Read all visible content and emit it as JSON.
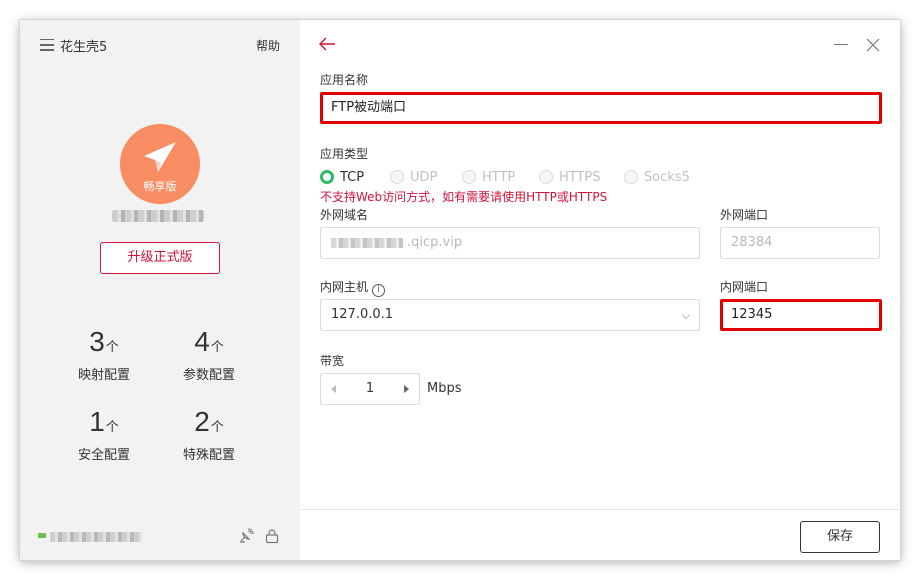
{
  "app": {
    "title": "花生壳5",
    "help": "帮助"
  },
  "sidebar": {
    "logo_badge": "畅享版",
    "upgrade_label": "升级正式版",
    "unit": "个",
    "stats": [
      {
        "value": "3",
        "label": "映射配置"
      },
      {
        "value": "4",
        "label": "参数配置"
      },
      {
        "value": "1",
        "label": "安全配置"
      },
      {
        "value": "2",
        "label": "特殊配置"
      }
    ]
  },
  "form": {
    "app_name_label": "应用名称",
    "app_name_value": "FTP被动端口",
    "app_type_label": "应用类型",
    "types": [
      "TCP",
      "UDP",
      "HTTP",
      "HTTPS",
      "Socks5"
    ],
    "selected_type": "TCP",
    "warning": "不支持Web访问方式，如有需要请使用HTTP或HTTPS",
    "external_domain_label": "外网域名",
    "external_domain_suffix": ".qicp.vip",
    "external_port_label": "外网端口",
    "external_port_value": "28384",
    "internal_host_label": "内网主机",
    "internal_host_value": "127.0.0.1",
    "internal_port_label": "内网端口",
    "internal_port_value": "12345",
    "bandwidth_label": "带宽",
    "bandwidth_value": "1",
    "bandwidth_unit": "Mbps",
    "save_label": "保存"
  },
  "colors": {
    "accent": "#d0143c",
    "highlight": "#e10000",
    "success": "#2fba66",
    "logo": "#f88c63"
  }
}
